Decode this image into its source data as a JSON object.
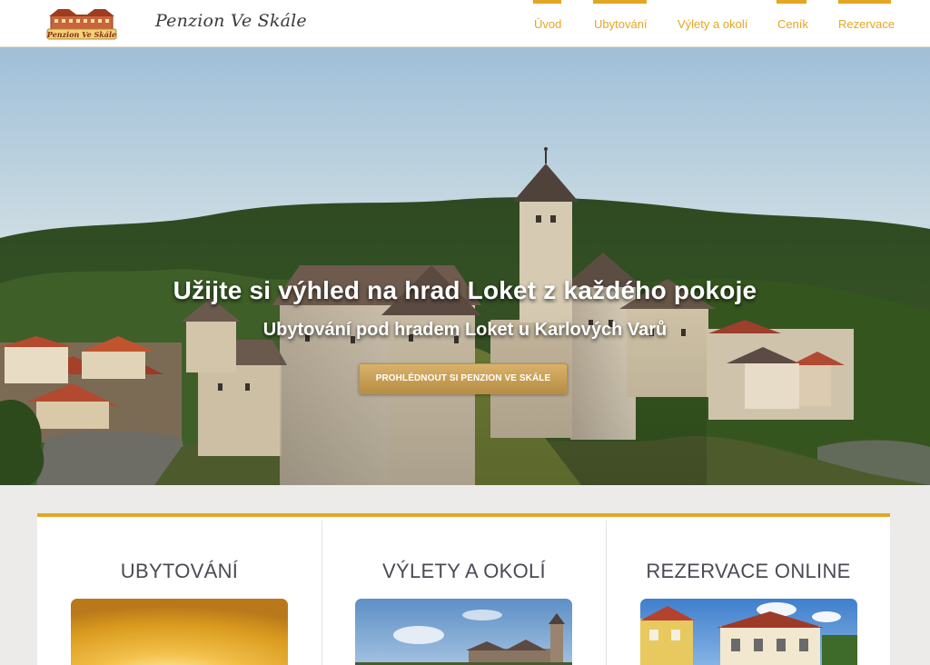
{
  "header": {
    "logo_text": "Penzion Ve Skále",
    "brand_title": "Penzion Ve Skále",
    "nav": [
      {
        "label": "Úvod",
        "active": true
      },
      {
        "label": "Ubytování",
        "active": true
      },
      {
        "label": "Výlety a okolí",
        "active": false
      },
      {
        "label": "Ceník",
        "active": true
      },
      {
        "label": "Rezervace",
        "active": true
      }
    ]
  },
  "hero": {
    "title": "Užijte si výhled na hrad Loket z každého pokoje",
    "subtitle": "Ubytování pod hradem Loket u Karlových Varů",
    "cta_label": "PROHLÉDNOUT SI PENZION VE SKÁLE"
  },
  "cards": [
    {
      "title": "UBYTOVÁNÍ",
      "image": "sunset-photo"
    },
    {
      "title": "VÝLETY A OKOLÍ",
      "image": "castle-photo"
    },
    {
      "title": "REZERVACE ONLINE",
      "image": "pension-building-photo"
    }
  ],
  "colors": {
    "accent": "#e3a623",
    "button": "#c9a25a",
    "text_dark": "#4a4a55"
  }
}
